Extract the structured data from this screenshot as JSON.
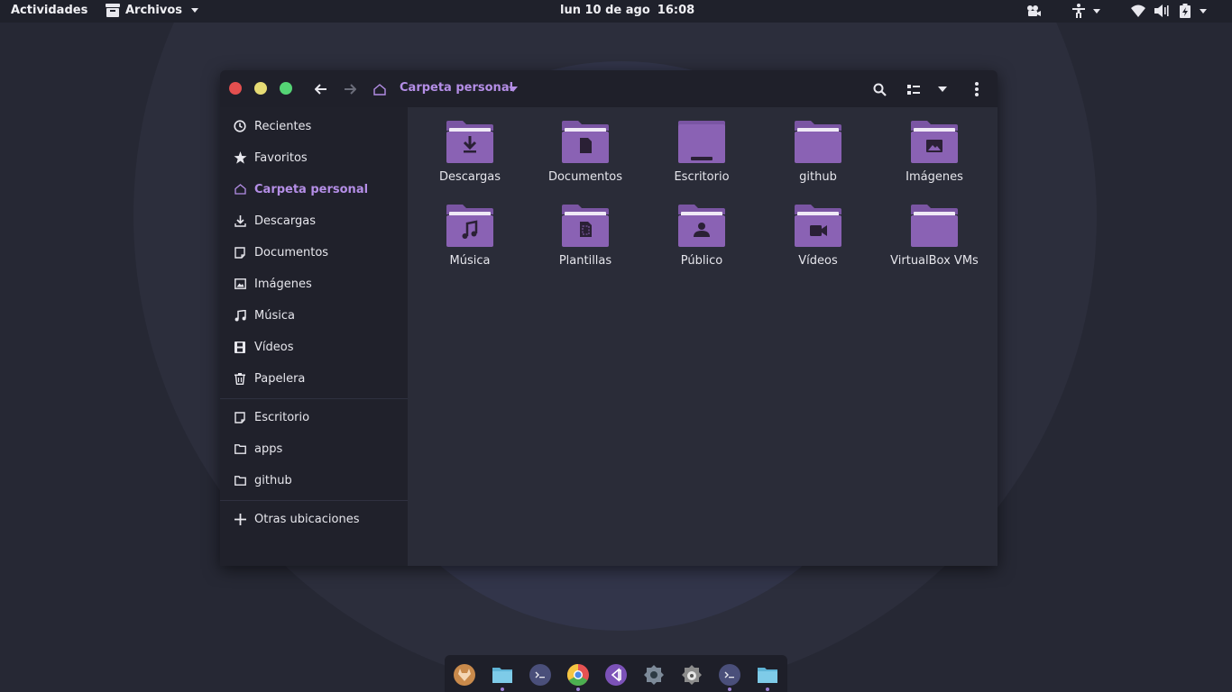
{
  "topbar": {
    "activities": "Actividades",
    "app_menu": "Archivos",
    "date": "lun 10 de ago",
    "time": "16:08",
    "tray_icons": [
      "camera-icon",
      "accessibility-icon",
      "wifi-icon",
      "volume-icon",
      "battery-icon"
    ]
  },
  "window": {
    "controls": [
      "close",
      "minimize",
      "maximize"
    ],
    "control_colors": {
      "close": "#e34f4f",
      "minimize": "#e6db74",
      "maximize": "#55d475"
    },
    "location": "Carpeta personal",
    "toolbar_icons": [
      "back-arrow-icon",
      "forward-arrow-icon",
      "home-icon",
      "search-icon",
      "view-list-icon",
      "chevron-down-icon",
      "kebab-menu-icon"
    ]
  },
  "sidebar": {
    "items": [
      {
        "label": "Recientes",
        "icon": "clock-icon"
      },
      {
        "label": "Favoritos",
        "icon": "star-icon"
      },
      {
        "label": "Carpeta personal",
        "icon": "home-icon",
        "active": true
      },
      {
        "label": "Descargas",
        "icon": "download-icon"
      },
      {
        "label": "Documentos",
        "icon": "document-icon"
      },
      {
        "label": "Imágenes",
        "icon": "image-icon"
      },
      {
        "label": "Música",
        "icon": "music-icon"
      },
      {
        "label": "Vídeos",
        "icon": "film-icon"
      },
      {
        "label": "Papelera",
        "icon": "trash-icon"
      }
    ],
    "bookmarks": [
      {
        "label": "Escritorio",
        "icon": "document-icon"
      },
      {
        "label": "apps",
        "icon": "folder-icon"
      },
      {
        "label": "github",
        "icon": "folder-icon"
      }
    ],
    "other": {
      "label": "Otras ubicaciones",
      "icon": "plus-icon"
    }
  },
  "files": [
    {
      "name": "Descargas",
      "emblem": "download"
    },
    {
      "name": "Documentos",
      "emblem": "document"
    },
    {
      "name": "Escritorio",
      "emblem": "desktop"
    },
    {
      "name": "github",
      "emblem": "none"
    },
    {
      "name": "Imágenes",
      "emblem": "image"
    },
    {
      "name": "Música",
      "emblem": "music"
    },
    {
      "name": "Plantillas",
      "emblem": "template"
    },
    {
      "name": "Público",
      "emblem": "person"
    },
    {
      "name": "Vídeos",
      "emblem": "video"
    },
    {
      "name": "VirtualBox VMs",
      "emblem": "none"
    }
  ],
  "colors": {
    "accent": "#b48ee6",
    "folder": "#8a62b4",
    "folder_tab": "#7a55a3"
  },
  "dock": {
    "apps": [
      {
        "name": "gitlab-icon",
        "running": false
      },
      {
        "name": "files-icon",
        "running": true
      },
      {
        "name": "terminal-icon",
        "running": false
      },
      {
        "name": "chrome-icon",
        "running": true
      },
      {
        "name": "vscode-icon",
        "running": true
      },
      {
        "name": "settings-icon",
        "running": false
      },
      {
        "name": "gimp-icon",
        "running": false
      },
      {
        "name": "terminal-icon",
        "running": true
      },
      {
        "name": "files-icon",
        "running": true
      }
    ]
  }
}
